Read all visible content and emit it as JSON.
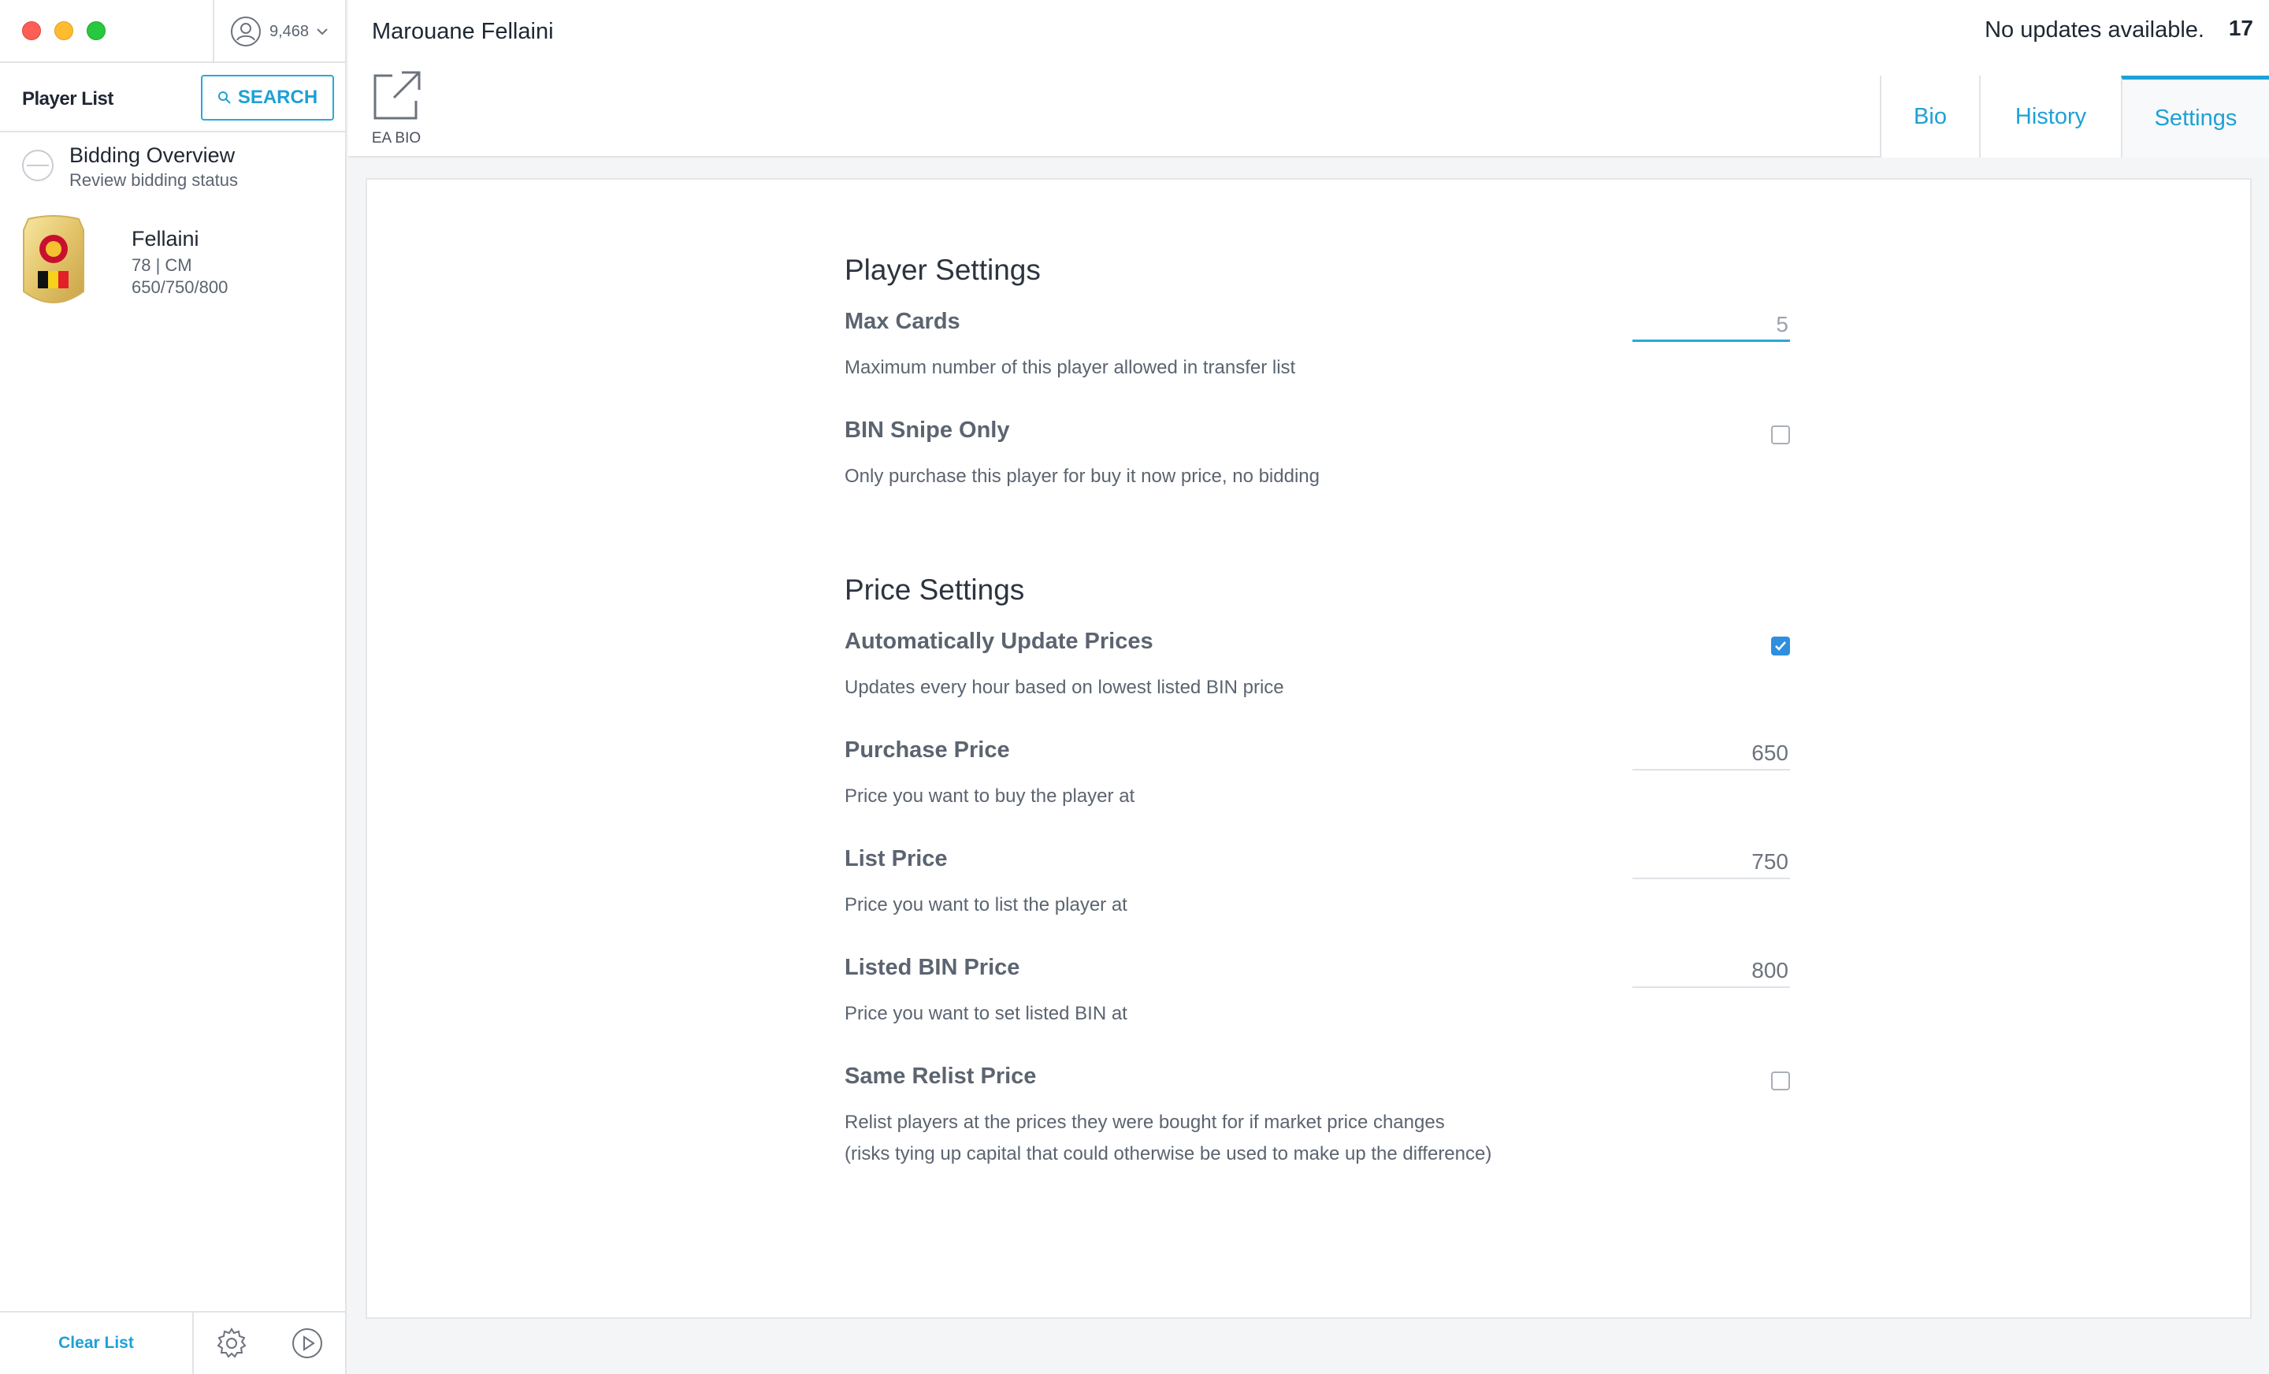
{
  "account": {
    "coins": "9,468"
  },
  "sidebar": {
    "title": "Player List",
    "search_label": "SEARCH",
    "bidding": {
      "title": "Bidding Overview",
      "subtitle": "Review bidding status"
    },
    "players": [
      {
        "name": "Fellaini",
        "rating_pos": "78 | CM",
        "prices": "650/750/800"
      }
    ],
    "footer": {
      "clear_label": "Clear List"
    }
  },
  "header": {
    "player_name": "Marouane Fellaini",
    "updates_status": "No updates available.",
    "version": "17",
    "ea_bio_label": "EA BIO"
  },
  "tabs": [
    {
      "label": "Bio",
      "active": false
    },
    {
      "label": "History",
      "active": false
    },
    {
      "label": "Settings",
      "active": true
    }
  ],
  "settings": {
    "player_section": {
      "title": "Player Settings",
      "max_cards": {
        "label": "Max Cards",
        "desc": "Maximum number of this player allowed in transfer list",
        "value": "5"
      },
      "bin_snipe": {
        "label": "BIN Snipe Only",
        "desc": "Only purchase this player for buy it now price, no bidding",
        "checked": false
      }
    },
    "price_section": {
      "title": "Price Settings",
      "auto_update": {
        "label": "Automatically Update Prices",
        "desc": "Updates every hour based on lowest listed BIN price",
        "checked": true
      },
      "purchase": {
        "label": "Purchase Price",
        "desc": "Price you want to buy the player at",
        "value": "650"
      },
      "list": {
        "label": "List Price",
        "desc": "Price you want to list the player at",
        "value": "750"
      },
      "listed_bin": {
        "label": "Listed BIN Price",
        "desc": "Price you want to set listed BIN at",
        "value": "800"
      },
      "same_relist": {
        "label": "Same Relist Price",
        "desc_line1": "Relist players at the prices they were bought for if market price changes",
        "desc_line2": "(risks tying up capital that could otherwise be used to make up the difference)",
        "checked": false
      }
    }
  },
  "colors": {
    "accent": "#1da1d6",
    "checkbox": "#2f8fde"
  },
  "icons": [
    "account-icon",
    "chevron-down-icon",
    "search-icon",
    "external-link-icon",
    "gear-icon",
    "play-icon",
    "checkmark-icon"
  ]
}
